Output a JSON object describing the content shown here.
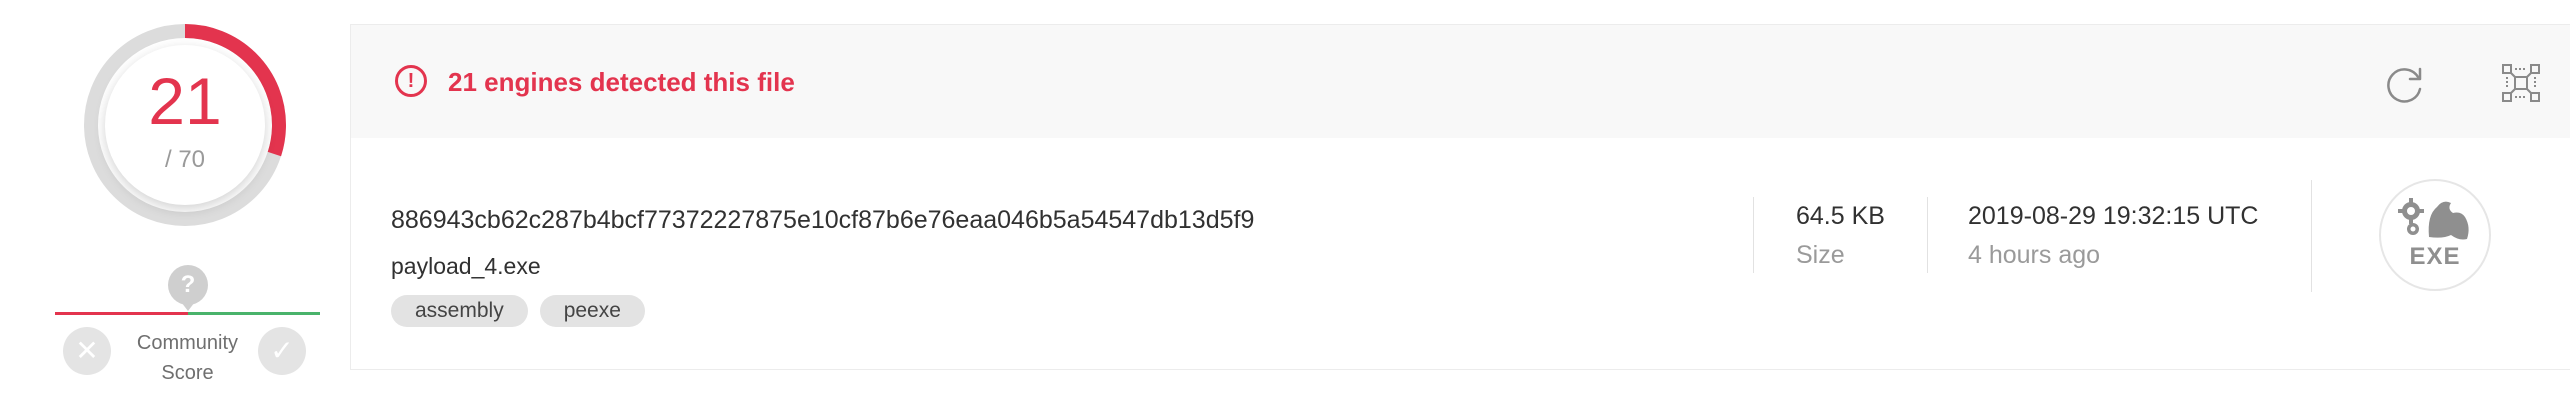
{
  "score": {
    "detected": "21",
    "total": "/ 70",
    "detected_count": 21,
    "total_count": 70,
    "accent_color": "#e3344e",
    "community": {
      "label_line1": "Community",
      "label_line2": "Score",
      "pin_symbol": "?",
      "down_symbol": "✕",
      "up_symbol": "✓"
    }
  },
  "header": {
    "alert_text": "21 engines detected this file",
    "alert_symbol": "!",
    "actions": [
      {
        "icon": "reanalyze-icon"
      },
      {
        "icon": "similar-files-icon"
      }
    ]
  },
  "file": {
    "hash": "886943cb62c287b4bcf77372227875e10cf87b6e76eaa046b5a54547db13d5f9",
    "name": "payload_4.exe",
    "tags": [
      "assembly",
      "peexe"
    ],
    "size_value": "64.5 KB",
    "size_label": "Size",
    "date_value": "2019-08-29 19:32:15 UTC",
    "date_relative": "4 hours ago",
    "type_label": "EXE",
    "type_icon": "exe-file-icon"
  },
  "colors": {
    "malicious": "#e3344e",
    "harmless": "#49b36b",
    "muted": "#9a9a9a"
  }
}
